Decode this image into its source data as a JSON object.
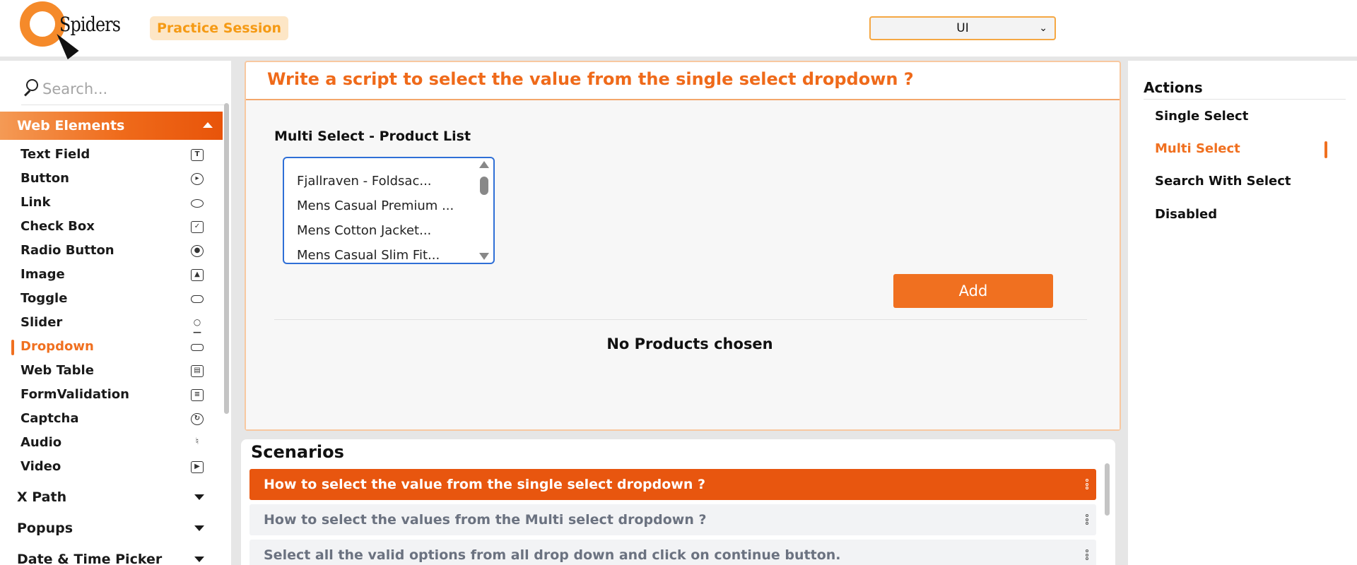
{
  "header": {
    "logo_text": "Spiders",
    "practice_label": "Practice Session",
    "mode_select_value": "UI"
  },
  "sidebar": {
    "search_placeholder": "Search...",
    "active_section": "Web Elements",
    "items": [
      {
        "label": "Text Field",
        "icon": "text-field-icon"
      },
      {
        "label": "Button",
        "icon": "play-circle-icon"
      },
      {
        "label": "Link",
        "icon": "link-icon"
      },
      {
        "label": "Check Box",
        "icon": "checkbox-icon"
      },
      {
        "label": "Radio Button",
        "icon": "radio-icon"
      },
      {
        "label": "Image",
        "icon": "image-icon"
      },
      {
        "label": "Toggle",
        "icon": "toggle-icon"
      },
      {
        "label": "Slider",
        "icon": "slider-icon"
      },
      {
        "label": "Dropdown",
        "icon": "dropdown-icon"
      },
      {
        "label": "Web Table",
        "icon": "table-icon"
      },
      {
        "label": "FormValidation",
        "icon": "form-icon"
      },
      {
        "label": "Captcha",
        "icon": "captcha-icon"
      },
      {
        "label": "Audio",
        "icon": "audio-icon"
      },
      {
        "label": "Video",
        "icon": "video-icon"
      }
    ],
    "active_item": "Dropdown",
    "collapsed_sections": [
      "X Path",
      "Popups",
      "Date & Time Picker"
    ]
  },
  "main": {
    "question": "Write a script to select the value from the single select dropdown ?",
    "list_label": "Multi Select - Product List",
    "list_options": [
      "Fjallraven - Foldsac...",
      "Mens Casual Premium ...",
      "Mens Cotton Jacket...",
      "Mens Casual Slim Fit..."
    ],
    "add_button": "Add",
    "empty_message": "No Products chosen"
  },
  "scenarios": {
    "title": "Scenarios",
    "items": [
      "How to select the value from the single select dropdown ?",
      "How to select the values from the Multi select dropdown ?",
      "Select all the valid options from all drop down and click on continue button."
    ],
    "active_index": 0
  },
  "actions": {
    "title": "Actions",
    "items": [
      "Single Select",
      "Multi Select",
      "Search With Select",
      "Disabled"
    ],
    "active_item": "Multi Select"
  },
  "colors": {
    "accent": "#f07020",
    "active_row": "#e8560f",
    "badge_bg": "#fde6c6",
    "listbox_border": "#2f6fd6"
  }
}
